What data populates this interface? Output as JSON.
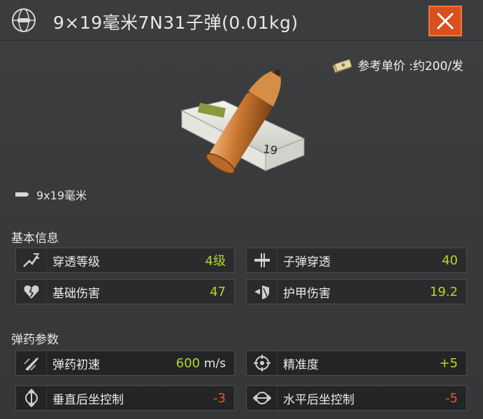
{
  "header": {
    "title": "9×19毫米7N31子弹(0.01kg)",
    "icon": "ammo-globe-icon",
    "close_icon": "close-icon"
  },
  "price": {
    "label": "参考单价 :约200/发",
    "icon": "cash-icon"
  },
  "caliber": {
    "label": "9x19毫米",
    "icon": "bullet-small-icon"
  },
  "basic_info": {
    "title": "基本信息",
    "stats": [
      {
        "label": "穿透等级",
        "value": "4级",
        "icon": "penetration-level-icon"
      },
      {
        "label": "子弹穿透",
        "value": "40",
        "icon": "bullet-penetration-icon"
      },
      {
        "label": "基础伤害",
        "value": "47",
        "icon": "broken-heart-icon"
      },
      {
        "label": "护甲伤害",
        "value": "19.2",
        "icon": "armor-damage-icon"
      }
    ]
  },
  "ammo_params": {
    "title": "弹药参数",
    "stats": [
      {
        "label": "弹药初速",
        "value": "600",
        "unit": "m/s",
        "icon": "velocity-icon"
      },
      {
        "label": "精准度",
        "value": "+5",
        "icon": "crosshair-icon"
      },
      {
        "label": "垂直后坐控制",
        "value": "-3",
        "icon": "vertical-recoil-icon"
      },
      {
        "label": "水平后坐控制",
        "value": "-5",
        "icon": "horizontal-recoil-icon"
      }
    ]
  },
  "colors": {
    "positive": "#b6d62a",
    "negative": "#f0532b",
    "close_button": "#d8501e"
  }
}
